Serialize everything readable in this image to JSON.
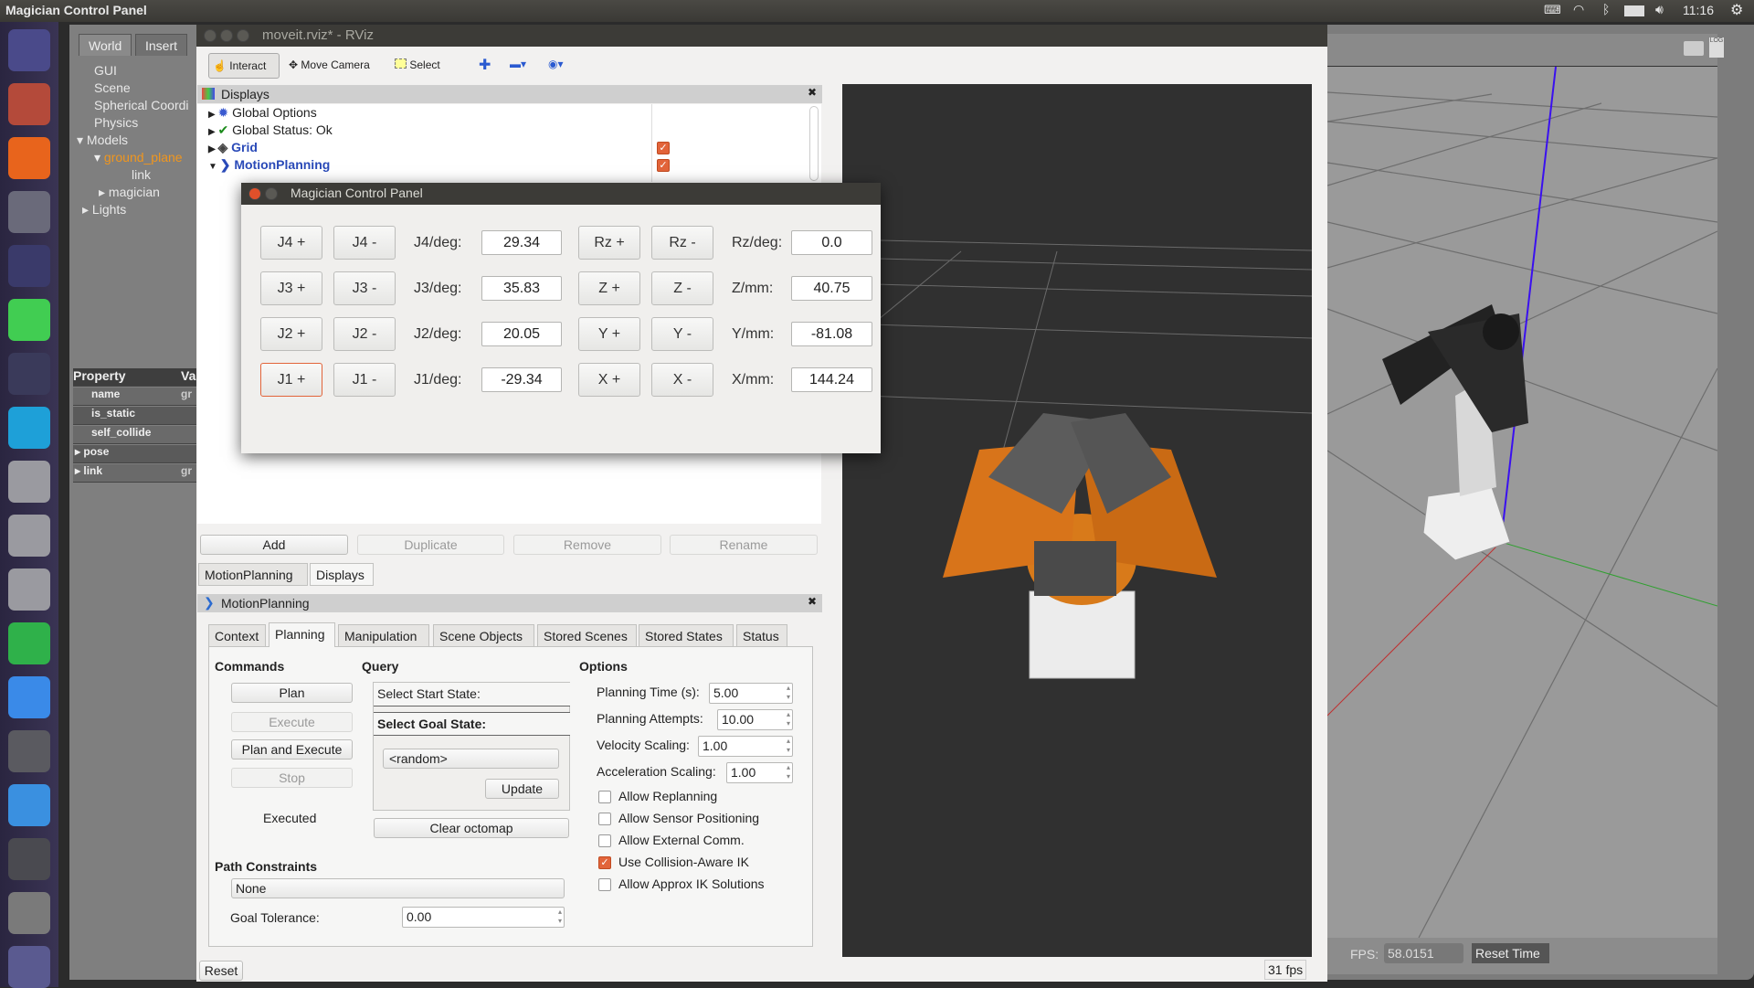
{
  "topbar": {
    "title": "Magician Control Panel",
    "clock": "11:16",
    "icons": [
      "keyboard-icon",
      "wifi-icon",
      "bluetooth-icon",
      "battery-icon",
      "volume-icon",
      "settings-gear-icon"
    ]
  },
  "launcher": {
    "items": [
      {
        "icon": "ubuntu-dash-icon",
        "color": "#4a4a8a"
      },
      {
        "icon": "file-manager-icon",
        "color": "#b44a3a"
      },
      {
        "icon": "firefox-icon",
        "color": "#e8641c"
      },
      {
        "icon": "system-settings-icon",
        "color": "#6a6a7a"
      },
      {
        "icon": "rviz-app-icon",
        "color": "#3a3a6a"
      },
      {
        "icon": "qt-creator-icon",
        "color": "#41cd52"
      },
      {
        "icon": "qq-penguin-icon",
        "color": "#3a3a5a"
      },
      {
        "icon": "gazebo-app-icon",
        "color": "#1ea0d8"
      },
      {
        "icon": "disk-drive-icon",
        "color": "#9a9aa0"
      },
      {
        "icon": "disk-drive-icon",
        "color": "#9a9aa0"
      },
      {
        "icon": "disk-drive-icon",
        "color": "#9a9aa0"
      },
      {
        "icon": "telegram-icon",
        "color": "#2fb14a"
      },
      {
        "icon": "wps-writer-icon",
        "color": "#3a8ae8"
      },
      {
        "icon": "gimp-icon",
        "color": "#5a5a60"
      },
      {
        "icon": "qv2ray-icon",
        "color": "#3a90e0"
      },
      {
        "icon": "terminal-icon",
        "color": "#4a4a50"
      },
      {
        "icon": "help-icon",
        "color": "#7a7a7a"
      },
      {
        "icon": "trash-icon",
        "color": "#5a5a90"
      }
    ]
  },
  "gazebo": {
    "tabs": [
      "World",
      "Insert"
    ],
    "tree": [
      "GUI",
      "Scene",
      "Spherical Coordi",
      "Physics",
      "Models",
      "ground_plane",
      "link",
      "magician",
      "Lights"
    ],
    "property_header": [
      "Property",
      "Va"
    ],
    "properties": [
      [
        "name",
        "gr"
      ],
      [
        "is_static",
        ""
      ],
      [
        "self_collide",
        ""
      ],
      [
        "pose",
        ""
      ],
      [
        "link",
        "gr"
      ]
    ],
    "fps_label": "FPS:",
    "fps_value": "58.0151",
    "reset_time": "Reset Time",
    "toolbar_icons": [
      "screenshot-camera-icon",
      "log-icon"
    ]
  },
  "rviz": {
    "title": "moveit.rviz* - RViz",
    "toolbar": {
      "interact": "Interact",
      "move_camera": "Move Camera",
      "select": "Select"
    },
    "displays_title": "Displays",
    "tree": [
      {
        "label": "Global Options",
        "checked": null
      },
      {
        "label": "Global Status: Ok",
        "checked": null
      },
      {
        "label": "Grid",
        "checked": true
      },
      {
        "label": "MotionPlanning",
        "checked": true
      }
    ],
    "buttons": {
      "add": "Add",
      "duplicate": "Duplicate",
      "remove": "Remove",
      "rename": "Rename"
    },
    "panel_tabs": [
      "MotionPlanning",
      "Displays"
    ],
    "mp_title": "MotionPlanning",
    "mp_tabs": [
      "Context",
      "Planning",
      "Manipulation",
      "Scene Objects",
      "Stored Scenes",
      "Stored States",
      "Status"
    ],
    "selected_tab": "Planning",
    "commands": {
      "title": "Commands",
      "plan": "Plan",
      "execute": "Execute",
      "plan_execute": "Plan and Execute",
      "stop": "Stop",
      "status": "Executed"
    },
    "query": {
      "title": "Query",
      "start": "Select Start State:",
      "goal": "Select Goal State:",
      "goal_value": "<random>",
      "update": "Update",
      "clear": "Clear octomap"
    },
    "options": {
      "title": "Options",
      "planning_time_label": "Planning Time (s):",
      "planning_time": "5.00",
      "attempts_label": "Planning Attempts:",
      "attempts": "10.00",
      "velocity_label": "Velocity Scaling:",
      "velocity": "1.00",
      "accel_label": "Acceleration Scaling:",
      "accel": "1.00",
      "checks": [
        {
          "label": "Allow Replanning",
          "checked": false
        },
        {
          "label": "Allow Sensor Positioning",
          "checked": false
        },
        {
          "label": "Allow External Comm.",
          "checked": false
        },
        {
          "label": "Use Collision-Aware IK",
          "checked": true
        },
        {
          "label": "Allow Approx IK Solutions",
          "checked": false
        }
      ]
    },
    "path": {
      "title": "Path Constraints",
      "value": "None",
      "tol_label": "Goal Tolerance:",
      "tol": "0.00"
    },
    "reset": "Reset",
    "fps": "31 fps"
  },
  "dialog": {
    "title": "Magician Control Panel",
    "rows": [
      {
        "jp": "J4 +",
        "jm": "J4 -",
        "jl": "J4/deg:",
        "jv": "29.34",
        "cp": "Rz +",
        "cm": "Rz -",
        "cl": "Rz/deg:",
        "cv": "0.0"
      },
      {
        "jp": "J3 +",
        "jm": "J3 -",
        "jl": "J3/deg:",
        "jv": "35.83",
        "cp": "Z +",
        "cm": "Z -",
        "cl": "Z/mm:",
        "cv": "40.75"
      },
      {
        "jp": "J2 +",
        "jm": "J2 -",
        "jl": "J2/deg:",
        "jv": "20.05",
        "cp": "Y +",
        "cm": "Y -",
        "cl": "Y/mm:",
        "cv": "-81.08"
      },
      {
        "jp": "J1 +",
        "jm": "J1 -",
        "jl": "J1/deg:",
        "jv": "-29.34",
        "cp": "X +",
        "cm": "X -",
        "cl": "X/mm:",
        "cv": "144.24"
      }
    ]
  }
}
